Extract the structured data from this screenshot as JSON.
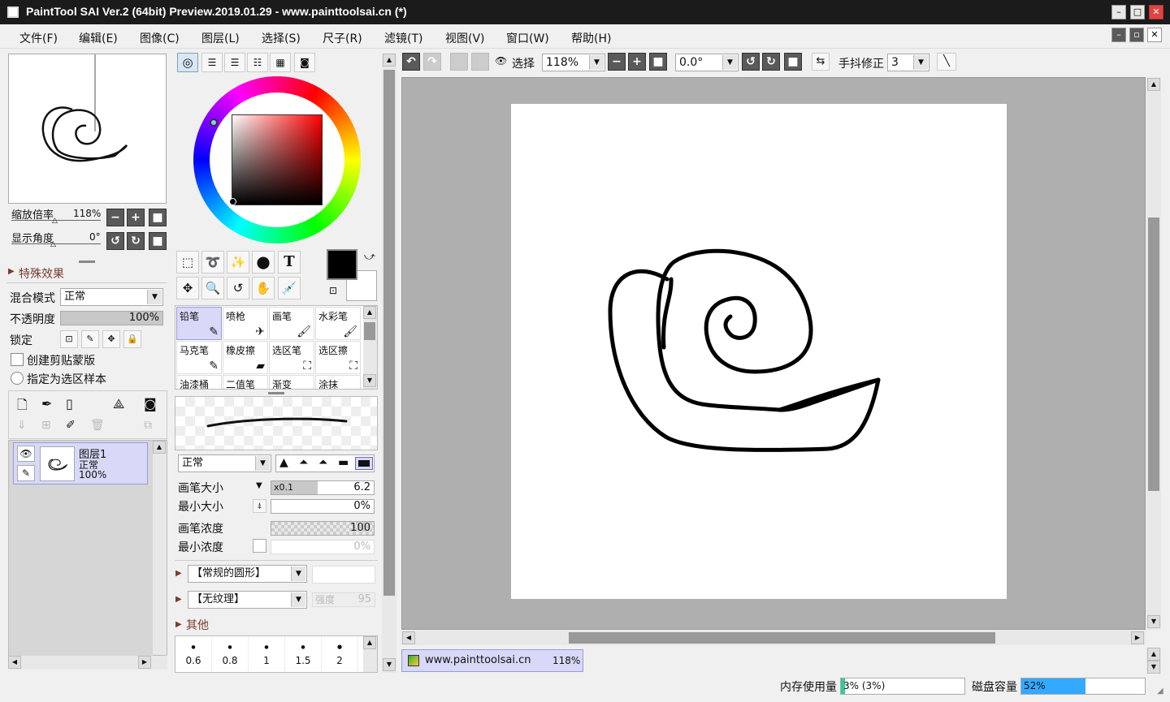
{
  "window": {
    "title": "PaintTool SAI Ver.2 (64bit) Preview.2019.01.29 - www.painttoolsai.cn (*)"
  },
  "menu": [
    "文件(F)",
    "编辑(E)",
    "图像(C)",
    "图层(L)",
    "选择(S)",
    "尺子(R)",
    "滤镜(T)",
    "视图(V)",
    "窗口(W)",
    "帮助(H)"
  ],
  "navigator": {
    "zoom_label": "缩放倍率",
    "zoom_value": "118%",
    "angle_label": "显示角度",
    "angle_value": "0°"
  },
  "layer_props": {
    "effects_label": "特殊效果",
    "blend_label": "混合模式",
    "blend_value": "正常",
    "opacity_label": "不透明度",
    "opacity_value": "100%",
    "opacity_level": 1.0,
    "lock_label": "锁定",
    "clip_label": "创建剪贴蒙版",
    "sample_label": "指定为选区样本"
  },
  "layers": [
    {
      "name": "图层1",
      "mode": "正常",
      "opacity": "100%"
    }
  ],
  "brushes": [
    [
      "铅笔",
      "喷枪",
      "画笔",
      "水彩笔"
    ],
    [
      "马克笔",
      "橡皮擦",
      "选区笔",
      "选区擦"
    ],
    [
      "油漆桶",
      "二值笔",
      "渐变",
      "涂抹"
    ]
  ],
  "brush_settings": {
    "blend_value": "正常",
    "size_label": "画笔大小",
    "size_mult": "x0.1",
    "size_value": "6.2",
    "size_level": 0.45,
    "min_size_label": "最小大小",
    "min_size_value": "0%",
    "density_label": "画笔浓度",
    "density_value": "100",
    "min_density_label": "最小浓度",
    "min_density_value": "0%",
    "shape_value": "【常规的圆形】",
    "texture_value": "【无纹理】",
    "strength_label": "强度",
    "strength_value": "95",
    "other_label": "其他",
    "sizes": [
      "0.6",
      "0.8",
      "1",
      "1.5",
      "2"
    ]
  },
  "toolbar": {
    "select_label": "选择",
    "zoom_value": "118%",
    "angle_value": "0.0°",
    "stabilizer_label": "手抖修正",
    "stabilizer_value": "3"
  },
  "doc_tab": {
    "name": "www.painttoolsai.cn",
    "zoom": "118%"
  },
  "status": {
    "memory_label": "内存使用量",
    "memory_value": "3% (3%)",
    "memory_level": 0.03,
    "disk_label": "磁盘容量",
    "disk_value": "52%",
    "disk_level": 0.52
  },
  "colors": {
    "accent": "#3399ff",
    "layer_selected": "#d8d8f8",
    "memory_fill": "#33cc99",
    "disk_fill": "#33aaff"
  }
}
